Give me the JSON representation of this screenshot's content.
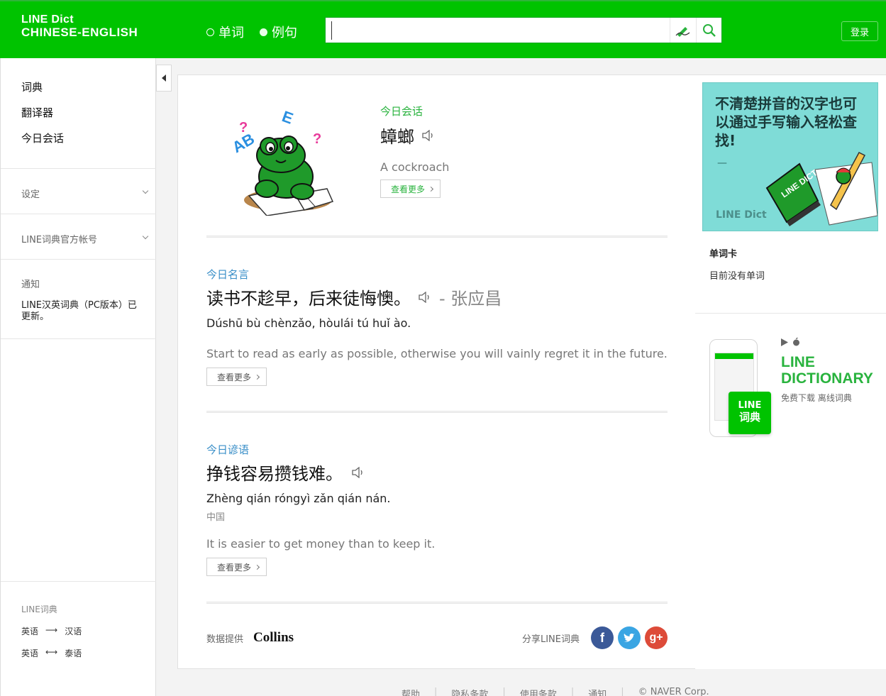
{
  "header": {
    "logo_line1": "LINE Dict",
    "logo_line2": "CHINESE-ENGLISH",
    "mode_word": "单词",
    "mode_sentence": "例句",
    "search_value": "",
    "login_label": "登录"
  },
  "sidebar": {
    "nav": [
      "词典",
      "翻译器",
      "今日会话"
    ],
    "settings_label": "设定",
    "official_label": "LINE词典官方帐号",
    "notice_title": "通知",
    "notice_text": "LINE汉英词典（PC版本）已更新。",
    "footer_title": "LINE词典",
    "link1_from": "英语",
    "link1_arrow": "⟶",
    "link1_to": "汉语",
    "link2_from": "英语",
    "link2_arrow": "⟷",
    "link2_to": "泰语"
  },
  "conversation": {
    "label": "今日会话",
    "word": "蟑螂",
    "translation": "A cockroach",
    "more": "查看更多"
  },
  "quote": {
    "label": "今日名言",
    "text": "读书不趁早，后来徒悔懊。",
    "author": "- 张应昌",
    "pinyin": "Dúshū bù chènzǎo, hòulái tú huǐ ào.",
    "translation": "Start to read as early as possible, otherwise you will vainly regret it in the future.",
    "more": "查看更多"
  },
  "proverb": {
    "label": "今日谚语",
    "text": "挣钱容易攒钱难。",
    "pinyin": "Zhèng qián róngyì zǎn qián nán.",
    "origin": "中国",
    "translation": "It is easier to get money than to keep it.",
    "more": "查看更多"
  },
  "credits": {
    "data_label": "数据提供",
    "provider": "Collins",
    "share_label": "分享LINE词典",
    "share_icons": [
      "facebook-icon",
      "twitter-icon",
      "google-plus-icon"
    ]
  },
  "promo": {
    "text": "不清楚拼音的汉字也可以通过手写输入轻松查找!",
    "dash": "—",
    "brand": "LINE Dict",
    "book_text": "LINE DICT"
  },
  "wordcard": {
    "title": "单词卡",
    "empty": "目前没有单词"
  },
  "app": {
    "title_line1": "LINE",
    "title_line2": "DICTIONARY",
    "subtitle": "免费下载 离线词典",
    "badge_line1": "LINE",
    "badge_line2": "词典"
  },
  "footer": {
    "links": [
      "帮助",
      "隐私条款",
      "使用条款",
      "通知",
      "© NAVER Corp."
    ]
  },
  "colors": {
    "brand_green": "#00c300",
    "label_green": "#29b33e",
    "label_blue": "#3a8fc8",
    "promo_bg": "#7fdcd7"
  }
}
